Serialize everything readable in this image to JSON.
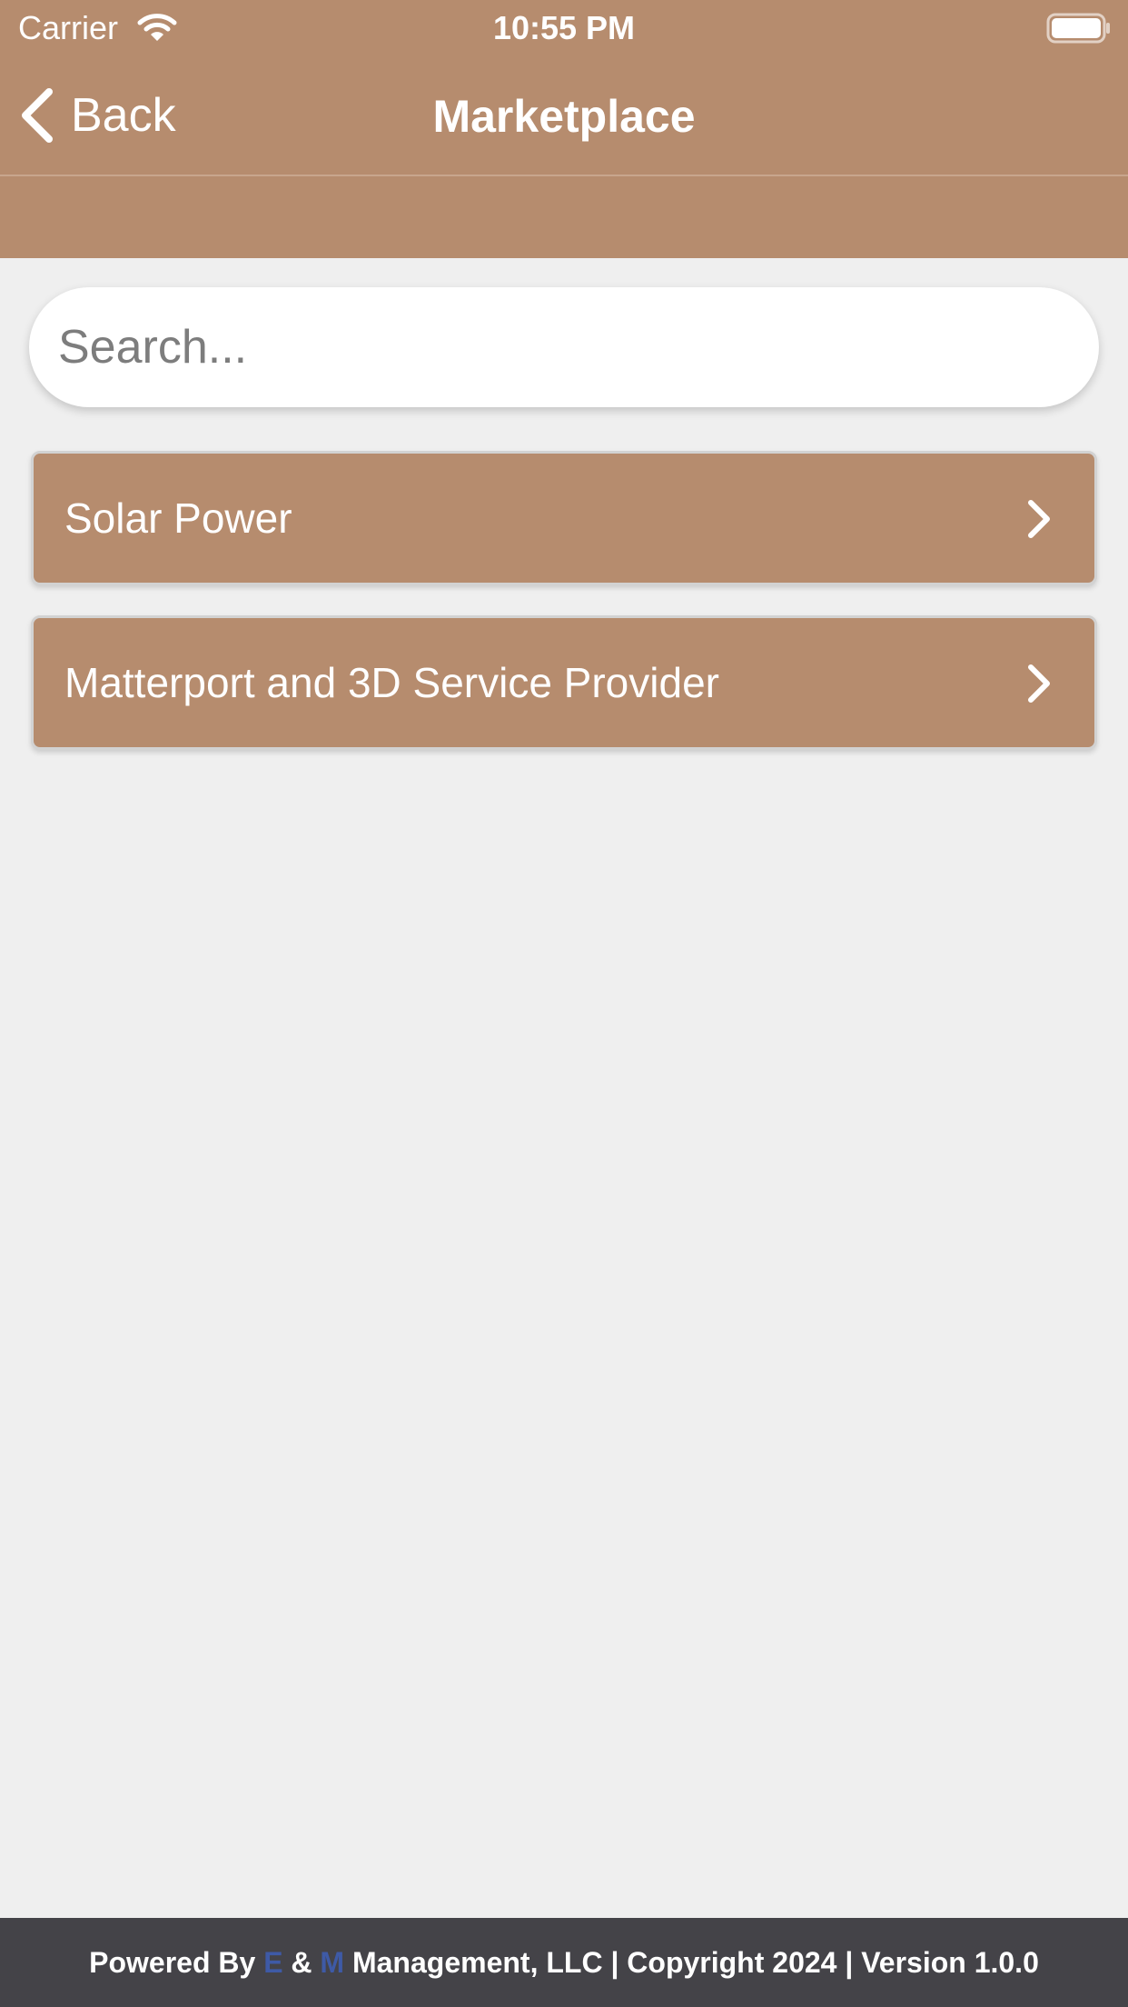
{
  "status_bar": {
    "carrier": "Carrier",
    "time": "10:55 PM",
    "icons": [
      "wifi-icon",
      "battery-icon"
    ]
  },
  "nav": {
    "back_label": "Back",
    "title": "Marketplace",
    "back_icon": "chevron-left-icon"
  },
  "search": {
    "placeholder": "Search...",
    "value": ""
  },
  "categories": [
    {
      "label": "Solar Power",
      "icon": "chevron-right-icon"
    },
    {
      "label": "Matterport and 3D Service Provider",
      "icon": "chevron-right-icon"
    }
  ],
  "footer": {
    "prefix": "Powered By",
    "letter_e": "E",
    "ampersand": "&",
    "letter_m": "M",
    "suffix": "Management, LLC | Copyright 2024 | Version 1.0.0"
  },
  "colors": {
    "header": "#b68c6e",
    "background": "#efefef",
    "item": "#b68c6e",
    "footer": "#444348",
    "footer_accent": "#3e5aa6"
  }
}
